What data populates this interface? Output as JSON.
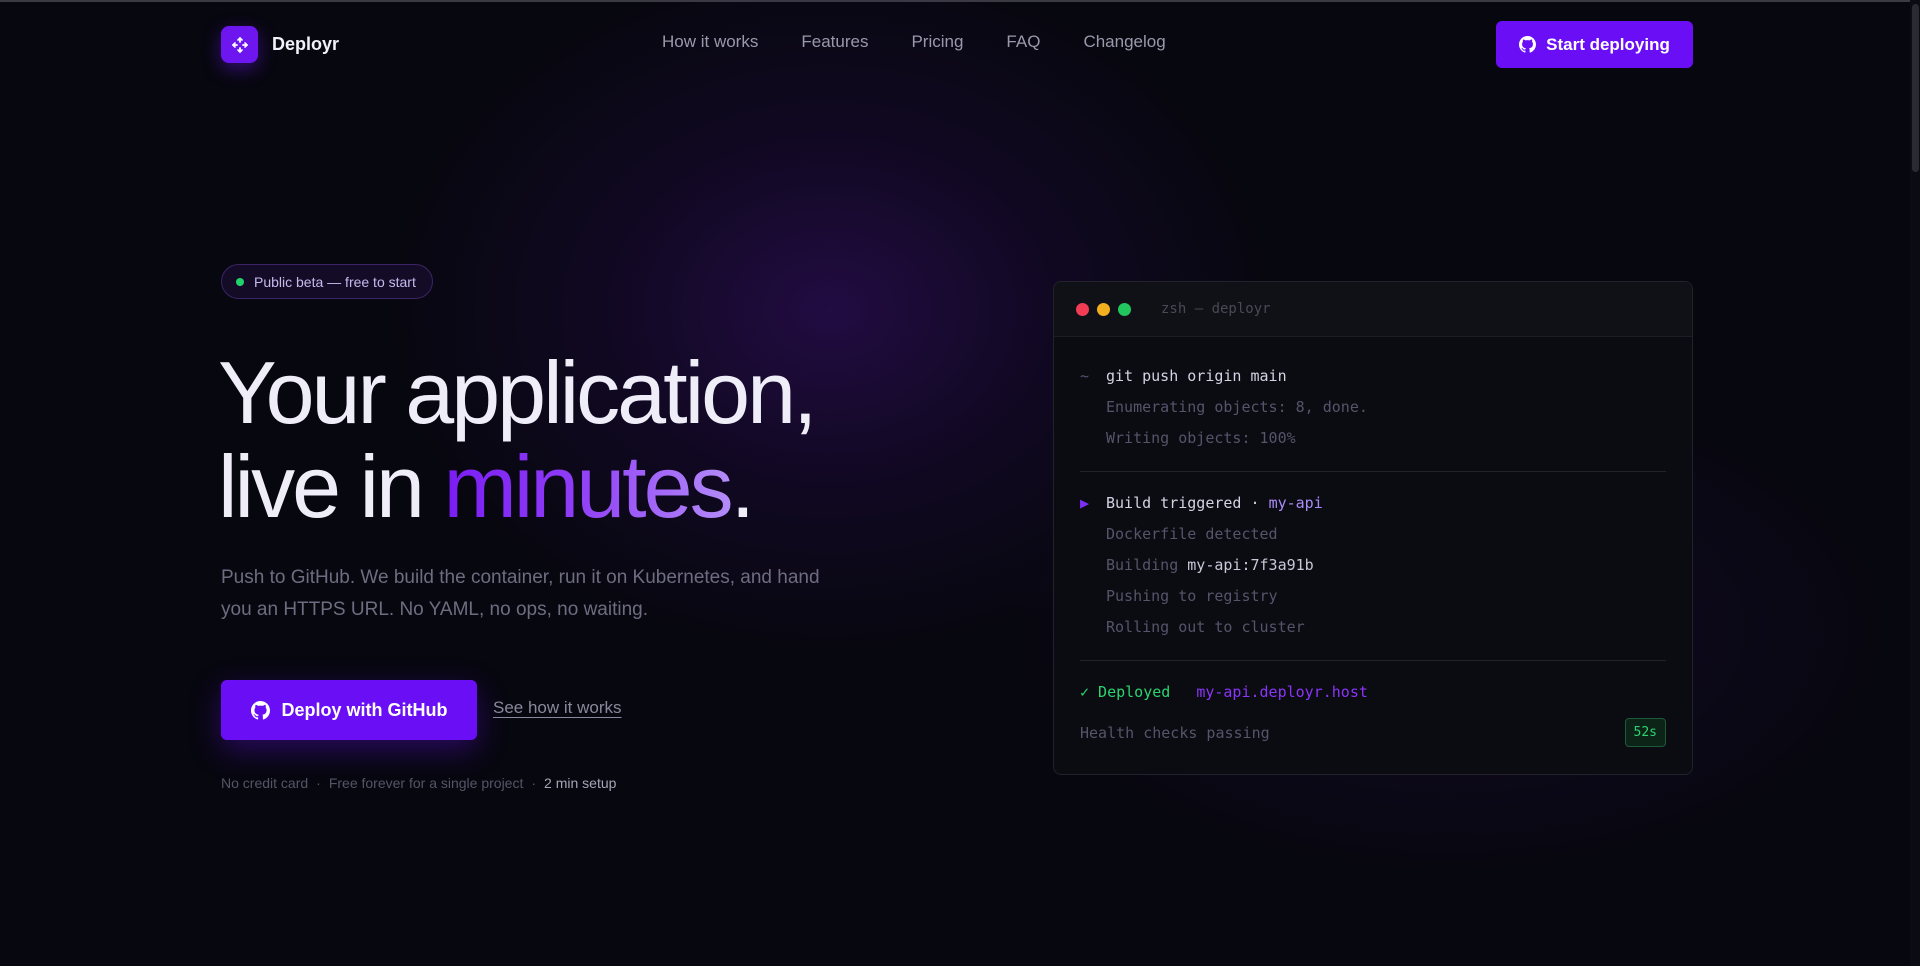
{
  "brand": {
    "name": "Deployr"
  },
  "nav": {
    "links": [
      "How it works",
      "Features",
      "Pricing",
      "FAQ",
      "Changelog"
    ],
    "cta_label": "Start deploying"
  },
  "hero": {
    "badge": "Public beta — free to start",
    "headline_line1": "Your application,",
    "headline_line2_prefix": "live in ",
    "headline_accent": "minutes",
    "headline_period": ".",
    "subtext": "Push to GitHub. We build the container, run it on Kubernetes, and hand you an HTTPS URL. No YAML, no ops, no waiting.",
    "primary_cta": "Deploy with GitHub",
    "secondary_cta": "See how it works",
    "fineprint": {
      "item1": "No credit card",
      "item2": "Free forever for a single project",
      "item3": "2 min setup",
      "separator": "·"
    }
  },
  "terminal": {
    "title": "zsh — deployr",
    "prompt": "~",
    "command": "git push origin main",
    "push_output": [
      "Enumerating objects: 8, done.",
      "Writing objects: 100%"
    ],
    "build_marker": "▶",
    "build_label": "Build triggered · ",
    "build_app": "my-api",
    "steps": {
      "dockerfile": "Dockerfile detected",
      "building_prefix": "Building ",
      "building_image": "my-api:7f3a91b",
      "pushing": "Pushing to registry",
      "rolling": "Rolling out to cluster"
    },
    "deployed_label": "✓ Deployed",
    "deployed_url": "my-api.deployr.host",
    "health": "Health checks passing",
    "duration": "52s"
  },
  "colors": {
    "accent": "#6a0ff5",
    "background": "#07070f",
    "success": "#2bd46f",
    "traffic_red": "#f23b55",
    "traffic_yellow": "#f2b01e",
    "traffic_green": "#22c55e"
  }
}
